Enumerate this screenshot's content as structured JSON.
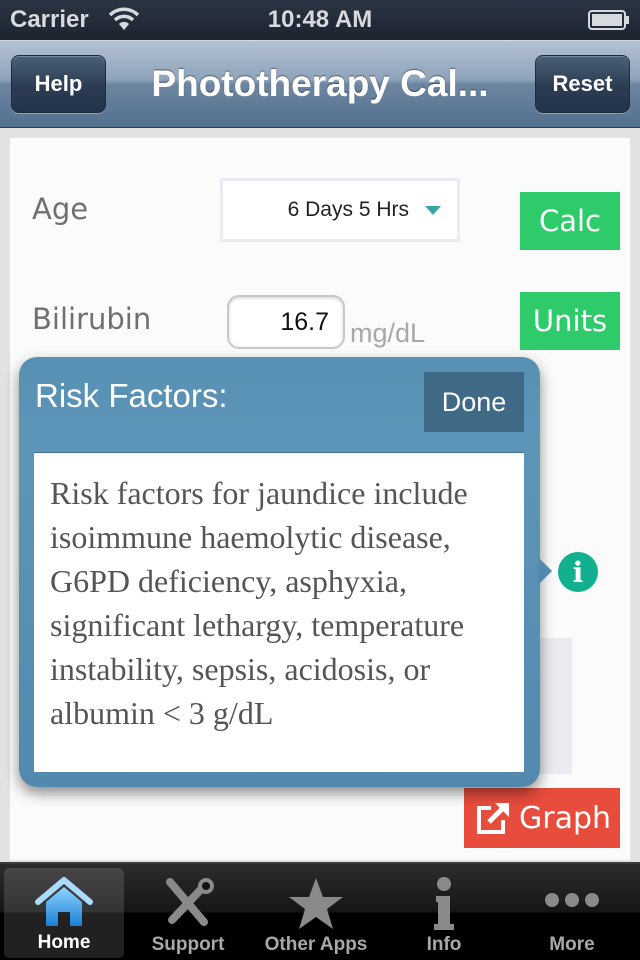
{
  "status_bar": {
    "carrier": "Carrier",
    "time": "10:48 AM",
    "wifi_icon": "wifi-icon",
    "battery_icon": "battery-icon"
  },
  "nav_bar": {
    "title": "Phototherapy Cal...",
    "left_button": "Help",
    "right_button": "Reset"
  },
  "form": {
    "age_label": "Age",
    "age_value": "6 Days 5 Hrs",
    "bilirubin_label": "Bilirubin",
    "bilirubin_value": "16.7",
    "bilirubin_unit": "mg/dL",
    "calc_button": "Calc",
    "units_button": "Units",
    "graph_button": "Graph",
    "info_icon": "info-icon"
  },
  "colors": {
    "green_button": "#2ecb6b",
    "red_button": "#e74c3c",
    "info_teal": "#13b08f",
    "popover_blue": "#5890b3",
    "done_button": "#3e6a86"
  },
  "popover": {
    "title": "Risk Factors:",
    "done_button": "Done",
    "body": "Risk factors for jaundice include isoimmune haemolytic disease, G6PD deficiency, asphyxia, significant lethargy, temperature instability, sepsis, acidosis, or albumin < 3 g/dL"
  },
  "tab_bar": {
    "items": [
      {
        "label": "Home",
        "icon": "home-icon",
        "active": true
      },
      {
        "label": "Support",
        "icon": "tools-icon",
        "active": false
      },
      {
        "label": "Other Apps",
        "icon": "star-icon",
        "active": false
      },
      {
        "label": "Info",
        "icon": "info-icon",
        "active": false
      },
      {
        "label": "More",
        "icon": "more-icon",
        "active": false
      }
    ]
  }
}
